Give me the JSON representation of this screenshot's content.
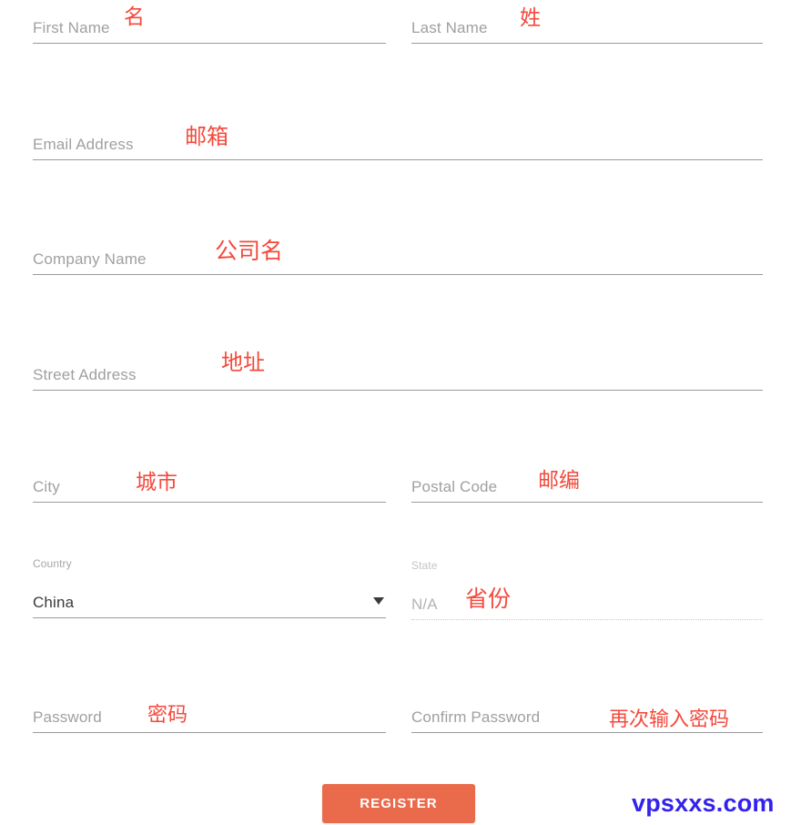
{
  "form": {
    "fields": [
      {
        "key": "first_name",
        "name": "first-name",
        "placeholder": "First Name",
        "value": "",
        "annotation": "名",
        "state": "empty"
      },
      {
        "key": "last_name",
        "name": "last-name",
        "placeholder": "Last Name",
        "value": "",
        "annotation": "姓",
        "state": "empty"
      },
      {
        "key": "email_address",
        "name": "email-address",
        "placeholder": "Email Address",
        "value": "",
        "annotation": "邮箱",
        "state": "empty"
      },
      {
        "key": "company_name",
        "name": "company-name",
        "placeholder": "Company Name",
        "value": "",
        "annotation": "公司名",
        "state": "empty"
      },
      {
        "key": "street_address",
        "name": "street-address",
        "placeholder": "Street Address",
        "value": "",
        "annotation": "地址",
        "state": "empty"
      },
      {
        "key": "city",
        "name": "city",
        "placeholder": "City",
        "value": "",
        "annotation": "城市",
        "state": "empty"
      },
      {
        "key": "postal_code",
        "name": "postal-code",
        "placeholder": "Postal Code",
        "value": "",
        "annotation": "邮编",
        "state": "empty"
      },
      {
        "key": "country",
        "name": "country",
        "label": "Country",
        "value": "China",
        "annotation": "",
        "state": "filled",
        "control": "select",
        "caret_icon": "chevron-down-icon"
      },
      {
        "key": "state",
        "name": "state",
        "label": "State",
        "value": "N/A",
        "annotation": "省份",
        "state": "disabled",
        "control": "select"
      },
      {
        "key": "password",
        "name": "password",
        "placeholder": "Password",
        "value": "",
        "annotation": "密码",
        "state": "empty"
      },
      {
        "key": "confirm_password",
        "name": "confirm-password",
        "placeholder": "Confirm Password",
        "value": "",
        "annotation": "再次输入密码",
        "state": "empty"
      }
    ],
    "submit_label": "REGISTER"
  },
  "watermark": {
    "text": "vpsxxs.com"
  },
  "colors": {
    "submit_background": "#ea6a4c",
    "submit_text": "#ffffff",
    "annotation": "#f4493c",
    "watermark": "#3322ee",
    "placeholder": "#a0a0a0",
    "value": "#3b3b3b",
    "underline": "#9a9a9a",
    "underline_disabled": "#c9c9c9"
  }
}
